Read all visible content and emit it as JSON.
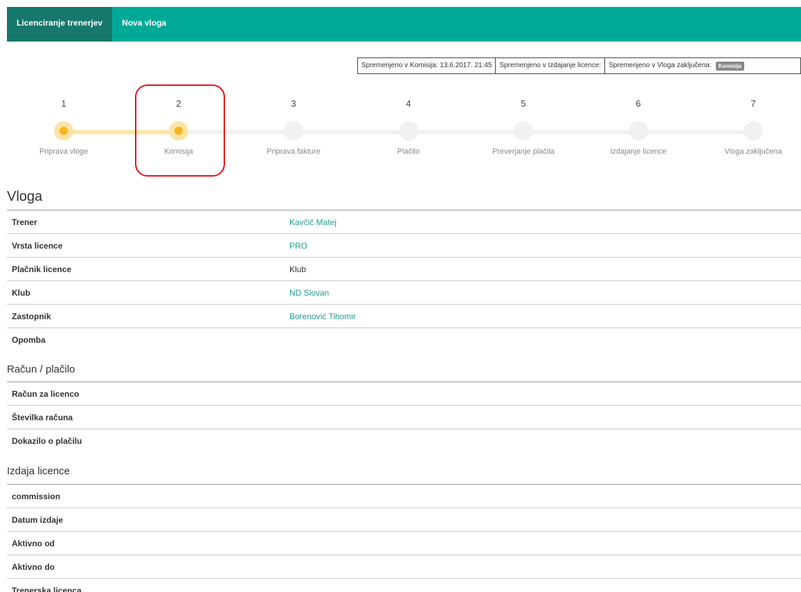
{
  "navbar": {
    "items": [
      {
        "label": "Licenciranje trenerjev",
        "active": true
      },
      {
        "label": "Nova vloga",
        "active": false
      }
    ]
  },
  "status_bar": {
    "cells": [
      "Spremenjeno v Komisija: 13.6.2017. 21:45",
      "Spremenjeno v Izdajanje licence:",
      "Spremenjeno v Vloga zaključena:"
    ],
    "badge": "Komisija"
  },
  "steps": [
    {
      "number": "1",
      "label": "Priprava vloge",
      "done": true
    },
    {
      "number": "2",
      "label": "Komisija",
      "done": true
    },
    {
      "number": "3",
      "label": "Priprava fakture",
      "done": false
    },
    {
      "number": "4",
      "label": "Plačilo",
      "done": false
    },
    {
      "number": "5",
      "label": "Preverjanje plačila",
      "done": false
    },
    {
      "number": "6",
      "label": "Izdajanje licence",
      "done": false
    },
    {
      "number": "7",
      "label": "Vloga zaključena",
      "done": false
    }
  ],
  "application": {
    "title": "Vloga",
    "rows": [
      {
        "label": "Trener",
        "value": "Kavčič Matej"
      },
      {
        "label": "Vrsta licence",
        "value": "PRO"
      },
      {
        "label": "Plačnik licence",
        "value": "Klub"
      },
      {
        "label": "Klub",
        "value": "ND Slovan"
      },
      {
        "label": "Zastopnik",
        "value": "Borenović Tihomir"
      },
      {
        "label": "Opomba",
        "value": ""
      }
    ]
  },
  "payment": {
    "title": "Račun / plačilo",
    "rows": [
      {
        "label": "Račun za licenco",
        "value": ""
      },
      {
        "label": "Številka računa",
        "value": ""
      },
      {
        "label": "Dokazilo o plačilu",
        "value": ""
      }
    ]
  },
  "issuance": {
    "title": "Izdaja licence",
    "rows": [
      {
        "label": "commission",
        "value": ""
      },
      {
        "label": "Datum izdaje",
        "value": ""
      },
      {
        "label": "Aktivno od",
        "value": ""
      },
      {
        "label": "Aktivno do",
        "value": ""
      },
      {
        "label": "Trenerska licenca",
        "value": ""
      }
    ]
  },
  "colors": {
    "brand": "#00a997",
    "brand_dark": "#16776b",
    "link": "#1e9e8f",
    "step_done": "#f9b41e",
    "step_done_light": "#fbe4a6",
    "highlight": "#e8101a"
  }
}
